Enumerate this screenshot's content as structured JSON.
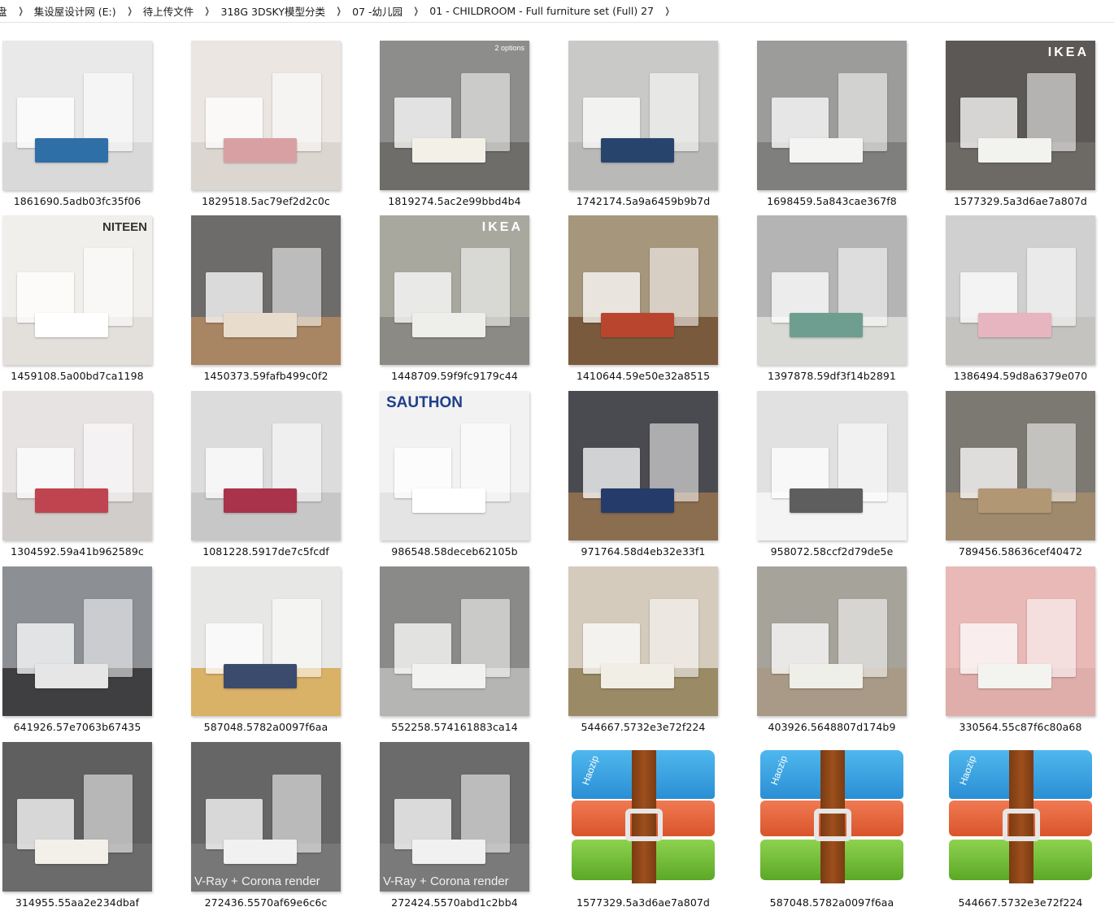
{
  "breadcrumb": [
    "盘",
    "集设屋设计网 (E:)",
    "待上传文件",
    "318G 3DSKY模型分类",
    "07 -幼儿园",
    "01 - CHILDROOM - Full furniture set (Full) 27"
  ],
  "files": [
    {
      "name": "1861690.5adb03fc35f06",
      "kind": "image",
      "bg": "#e9e9ea",
      "accent": "#2f6fa8",
      "floor": "#d9d9d9"
    },
    {
      "name": "1829518.5ac79ef2d2c0c",
      "kind": "image",
      "bg": "#ece6e2",
      "accent": "#d9a0a4",
      "floor": "#dcd6d0"
    },
    {
      "name": "1819274.5ac2e99bbd4b4",
      "kind": "image",
      "bg": "#8d8d8b",
      "accent": "#f3f0e8",
      "floor": "#6e6d6a",
      "overlay_text": "2 options"
    },
    {
      "name": "1742174.5a9a6459b9b7d",
      "kind": "image",
      "bg": "#c9c9c7",
      "accent": "#27456c",
      "floor": "#b9b9b7"
    },
    {
      "name": "1698459.5a843cae367f8",
      "kind": "image",
      "bg": "#9c9c9a",
      "accent": "#f4f4f2",
      "floor": "#7f7f7d"
    },
    {
      "name": "1577329.5a3d6ae7a807d",
      "kind": "image",
      "bg": "#5b5855",
      "accent": "#f2f2ee",
      "floor": "#6d6a66",
      "overlay_text": "IKEA"
    },
    {
      "name": "1459108.5a00bd7ca1198",
      "kind": "image",
      "bg": "#f1efec",
      "accent": "#ffffff",
      "floor": "#e3e0dc",
      "overlay_text": "NITEEN"
    },
    {
      "name": "1450373.59fafb499c0f2",
      "kind": "image",
      "bg": "#6d6c6b",
      "accent": "#e8dccd",
      "floor": "#a88563"
    },
    {
      "name": "1448709.59f9fc9179c44",
      "kind": "image",
      "bg": "#a9a89f",
      "accent": "#eeeeea",
      "floor": "#8c8a84",
      "overlay_text": "IKEA"
    },
    {
      "name": "1410644.59e50e32a8515",
      "kind": "image",
      "bg": "#a6967c",
      "accent": "#b9452e",
      "floor": "#7a5a3c"
    },
    {
      "name": "1397878.59df3f14b2891",
      "kind": "image",
      "bg": "#b3b4b3",
      "accent": "#6e9e8f",
      "floor": "#d9d9d6"
    },
    {
      "name": "1386494.59d8a6379e070",
      "kind": "image",
      "bg": "#cfd0cf",
      "accent": "#e7b5bf",
      "floor": "#c5c3bf"
    },
    {
      "name": "1304592.59a41b962589c",
      "kind": "image",
      "bg": "#e6e3e2",
      "accent": "#c0444f",
      "floor": "#d1cdcb"
    },
    {
      "name": "1081228.5917de7c5fcdf",
      "kind": "image",
      "bg": "#dcdcdc",
      "accent": "#a8334a",
      "floor": "#c7c7c7"
    },
    {
      "name": "986548.58deceb62105b",
      "kind": "image",
      "bg": "#f2f2f2",
      "accent": "#ffffff",
      "floor": "#e4e4e4",
      "overlay_text": "SAUTHON"
    },
    {
      "name": "971764.58d4eb32e33f1",
      "kind": "image",
      "bg": "#4a4b50",
      "accent": "#253b6a",
      "floor": "#8b6d50"
    },
    {
      "name": "958072.58ccf2d79de5e",
      "kind": "image",
      "bg": "#e1e1e1",
      "accent": "#5e5e5e",
      "floor": "#f4f4f4"
    },
    {
      "name": "789456.58636cef40472",
      "kind": "image",
      "bg": "#7c7872",
      "accent": "#b19774",
      "floor": "#a08a6d"
    },
    {
      "name": "641926.57e7063b67435",
      "kind": "image",
      "bg": "#8c8f94",
      "accent": "#e6e6e6",
      "floor": "#3f3f42"
    },
    {
      "name": "587048.5782a0097f6aa",
      "kind": "image",
      "bg": "#e7e7e5",
      "accent": "#3b4b6d",
      "floor": "#d9b167"
    },
    {
      "name": "552258.574161883ca14",
      "kind": "image",
      "bg": "#8a8a88",
      "accent": "#f2f2f0",
      "floor": "#b5b5b3"
    },
    {
      "name": "544667.5732e3e72f224",
      "kind": "image",
      "bg": "#d4cbbd",
      "accent": "#f1eee6",
      "floor": "#9a8a66"
    },
    {
      "name": "403926.5648807d174b9",
      "kind": "image",
      "bg": "#a6a39b",
      "accent": "#efefea",
      "floor": "#a89a86"
    },
    {
      "name": "330564.55c87f6c80a68",
      "kind": "image",
      "bg": "#e8b9b6",
      "accent": "#f3f3ef",
      "floor": "#dfaeab"
    },
    {
      "name": "314955.55aa2e234dbaf",
      "kind": "image",
      "bg": "#5f5f5f",
      "accent": "#f3f0ea",
      "floor": "#6b6b6b"
    },
    {
      "name": "272436.5570af69e6c6c",
      "kind": "image",
      "bg": "#666666",
      "accent": "#f1f1f1",
      "floor": "#777777",
      "overlay_text": "V-Ray + Corona render"
    },
    {
      "name": "272424.5570abd1c2bb4",
      "kind": "image",
      "bg": "#6b6b6b",
      "accent": "#f1f1f1",
      "floor": "#7a7a7a",
      "overlay_text": "V-Ray + Corona render"
    },
    {
      "name": "1577329.5a3d6ae7a807d",
      "kind": "archive",
      "brand": "Haozip"
    },
    {
      "name": "587048.5782a0097f6aa",
      "kind": "archive",
      "brand": "Haozip"
    },
    {
      "name": "544667.5732e3e72f224",
      "kind": "archive",
      "brand": "Haozip"
    }
  ]
}
